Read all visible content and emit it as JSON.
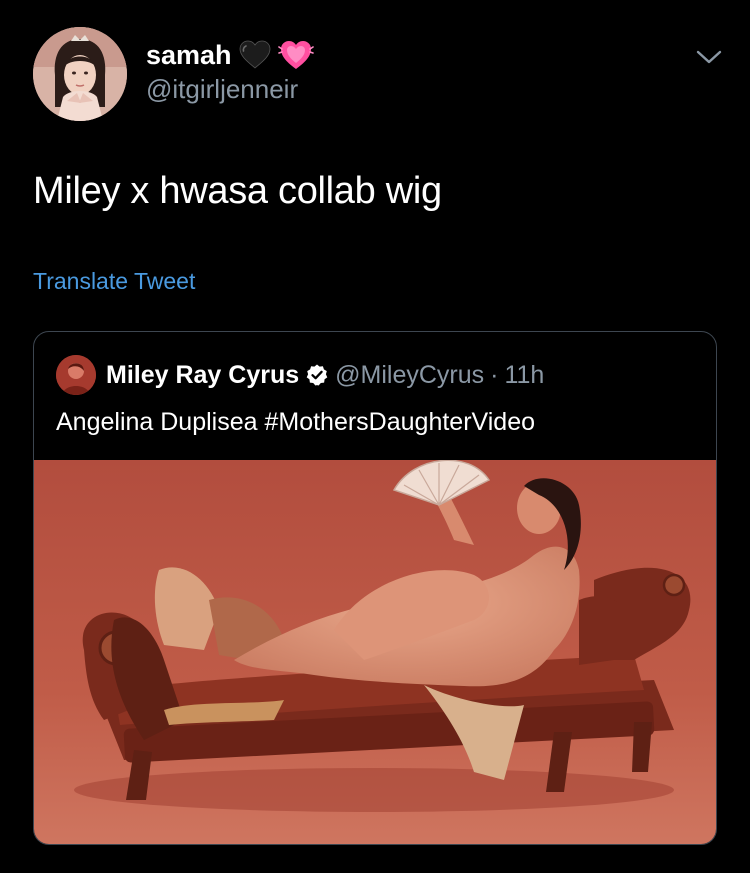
{
  "tweet": {
    "display_name": "samah",
    "handle": "@itgirljenneir",
    "text": "Miley x hwasa collab wig",
    "translate_label": "Translate Tweet",
    "name_emojis": [
      "black-heart-icon",
      "beating-pink-heart-icon"
    ]
  },
  "quoted": {
    "display_name": "Miley Ray Cyrus",
    "handle": "@MileyCyrus",
    "separator": "·",
    "time": "11h",
    "text": "Angelina Duplisea #MothersDaughterVideo",
    "verified": true
  },
  "colors": {
    "background": "#000000",
    "link": "#4a9ae0",
    "secondary_text": "#8b98a5",
    "card_border": "#3d4650",
    "photo_backdrop": "#b54f3f"
  }
}
